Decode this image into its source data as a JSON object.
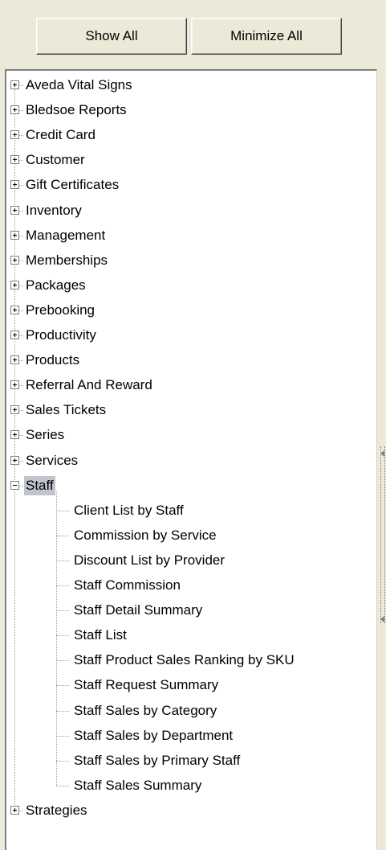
{
  "toolbar": {
    "show_all_label": "Show All",
    "minimize_all_label": "Minimize All"
  },
  "tree": {
    "categories_before": [
      {
        "label": "Aveda Vital Signs"
      },
      {
        "label": "Bledsoe Reports"
      },
      {
        "label": "Credit Card"
      },
      {
        "label": "Customer"
      },
      {
        "label": "Gift Certificates"
      },
      {
        "label": "Inventory"
      },
      {
        "label": "Management"
      },
      {
        "label": "Memberships"
      },
      {
        "label": "Packages"
      },
      {
        "label": "Prebooking"
      },
      {
        "label": "Productivity"
      },
      {
        "label": "Products"
      },
      {
        "label": "Referral And Reward"
      },
      {
        "label": "Sales Tickets"
      },
      {
        "label": "Series"
      },
      {
        "label": "Services"
      }
    ],
    "expanded": {
      "label": "Staff",
      "children": [
        "Client List by Staff",
        "Commission by Service",
        "Discount List by Provider",
        "Staff Commission",
        "Staff Detail Summary",
        "Staff List",
        "Staff Product Sales Ranking by SKU",
        "Staff Request Summary",
        "Staff Sales by Category",
        "Staff Sales by Department",
        "Staff Sales by Primary Staff",
        "Staff Sales Summary"
      ]
    },
    "categories_after": [
      {
        "label": "Strategies"
      }
    ]
  },
  "icons": {
    "expand": "plus-box-icon",
    "collapse": "minus-box-icon"
  }
}
